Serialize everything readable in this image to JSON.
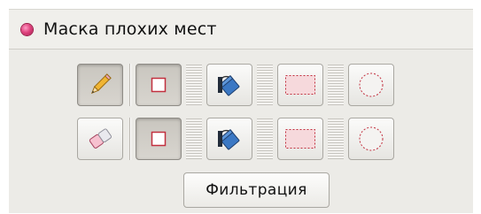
{
  "panel": {
    "title": "Маска плохих мест",
    "bullet_color": "#e0457f"
  },
  "toolbar": {
    "rows": [
      {
        "tool": {
          "icon": "pencil-icon",
          "pressed": true
        },
        "rect": {
          "icon": "square-icon",
          "pressed": true
        },
        "fill": {
          "icon": "paint-bucket-icon",
          "pressed": false
        },
        "selection": {
          "icon": "dashed-rectangle-icon",
          "pressed": false
        },
        "ellipse": {
          "icon": "dashed-circle-icon",
          "pressed": false
        }
      },
      {
        "tool": {
          "icon": "eraser-icon",
          "pressed": false
        },
        "rect": {
          "icon": "square-icon",
          "pressed": true
        },
        "fill": {
          "icon": "paint-bucket-icon",
          "pressed": false
        },
        "selection": {
          "icon": "dashed-rectangle-icon",
          "pressed": false
        },
        "ellipse": {
          "icon": "dashed-circle-icon",
          "pressed": false
        }
      }
    ]
  },
  "filter_button": {
    "label": "Фильтрация"
  }
}
